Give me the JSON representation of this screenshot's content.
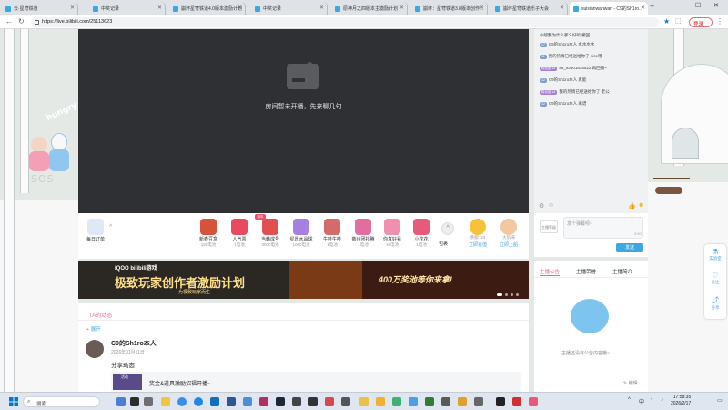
{
  "tabs": [
    {
      "label": "云·星穹铁道"
    },
    {
      "label": "中奖记录"
    },
    {
      "label": "崩坏星穹铁道4.0版本激励计划"
    },
    {
      "label": "中奖记录"
    },
    {
      "label": "原神月之四版本主激励计划"
    },
    {
      "label": "崩坏：星穹铁道3.8版本创作..."
    },
    {
      "label": "崩坏星穹铁道乐子大会"
    },
    {
      "label": "suisianwanwan - C9的Sh1ro..."
    }
  ],
  "address": {
    "url": "https://live.bilibili.com/25113623",
    "login": "登录"
  },
  "player": {
    "offline_text": "房间暂未开播，先来聊几句"
  },
  "scene": {
    "hungry": "hungry",
    "sos": "SOS"
  },
  "giftbar": {
    "left": {
      "label": "每日订单"
    },
    "gifts": [
      {
        "name": "新春豆盒",
        "price": "150电池",
        "color": "#d7523a"
      },
      {
        "name": "人气票",
        "price": "1电池",
        "color": "#e84a5f"
      },
      {
        "name": "当韩成号",
        "price": "3000电池",
        "color": "#e05050"
      },
      {
        "name": "星愿水晶球",
        "price": "1000电池",
        "color": "#a680e0"
      },
      {
        "name": "牛哇牛哇",
        "price": "1电池",
        "color": "#d46a6a"
      },
      {
        "name": "敬州团扑腾",
        "price": "1电池",
        "color": "#e06fa0"
      },
      {
        "name": "你真好看",
        "price": "10电池",
        "color": "#f08fb0"
      },
      {
        "name": "小花花",
        "price": "1电池",
        "color": "#e85a7a"
      }
    ],
    "new_tag": "新年",
    "more": "包裹",
    "battery": {
      "label": "立即充值",
      "value": "余额: 24"
    },
    "guard": {
      "label": "立即上船",
      "value": "大航海"
    }
  },
  "banner": {
    "brand": "iQOO  bilibili游戏",
    "title": "极致玩家创作者激励计划",
    "sub": "为极致玩家而生",
    "prize": "400万奖池等你来拿!"
  },
  "feed": {
    "tab": "TA的动态",
    "expand": "+ 展开",
    "post": {
      "user": "C9的Sh1ro本人",
      "date": "2026年01月11日",
      "text": "分享动态",
      "card_text": "奖金&道具激励招福开播~",
      "card_tag": "活动"
    }
  },
  "chat": {
    "messages": [
      {
        "medal": "",
        "text": "小螃蟹为什么那么好听  撤回"
      },
      {
        "medal": "17",
        "color": "#7f9fcd",
        "text": "C9的Sh1ro本人  水水水水"
      },
      {
        "medal": "11",
        "color": "#7f9fcd",
        "text": "我的热情已经送给你了 nice哦"
      },
      {
        "medal": "粉丝团 14",
        "color": "#a381d6",
        "text": "86_93901838522  再回播~"
      },
      {
        "medal": "12",
        "color": "#7f9fcd",
        "text": "C9的Sh1ro本人  真能"
      },
      {
        "medal": "粉丝团 14",
        "color": "#a381d6",
        "text": "我的热情已经送给你了 老公"
      },
      {
        "medal": "12",
        "color": "#7f9fcd",
        "text": "C9的Sh1ro本人  离谱"
      }
    ],
    "input_placeholder": "发个弹幕呗~",
    "count": "0/40",
    "level": "主播等级",
    "send": "发送"
  },
  "announcement": {
    "tabs": [
      "主播公告",
      "主播荣誉",
      "主播简介"
    ],
    "empty": "主播还没有公告内容哦~",
    "edit": "编辑"
  },
  "side": {
    "items": [
      "实验室",
      "关注",
      "分享"
    ]
  },
  "taskbar": {
    "search": "搜索",
    "time": "17:58:35",
    "date": "2026/2/17",
    "lang": "中"
  }
}
